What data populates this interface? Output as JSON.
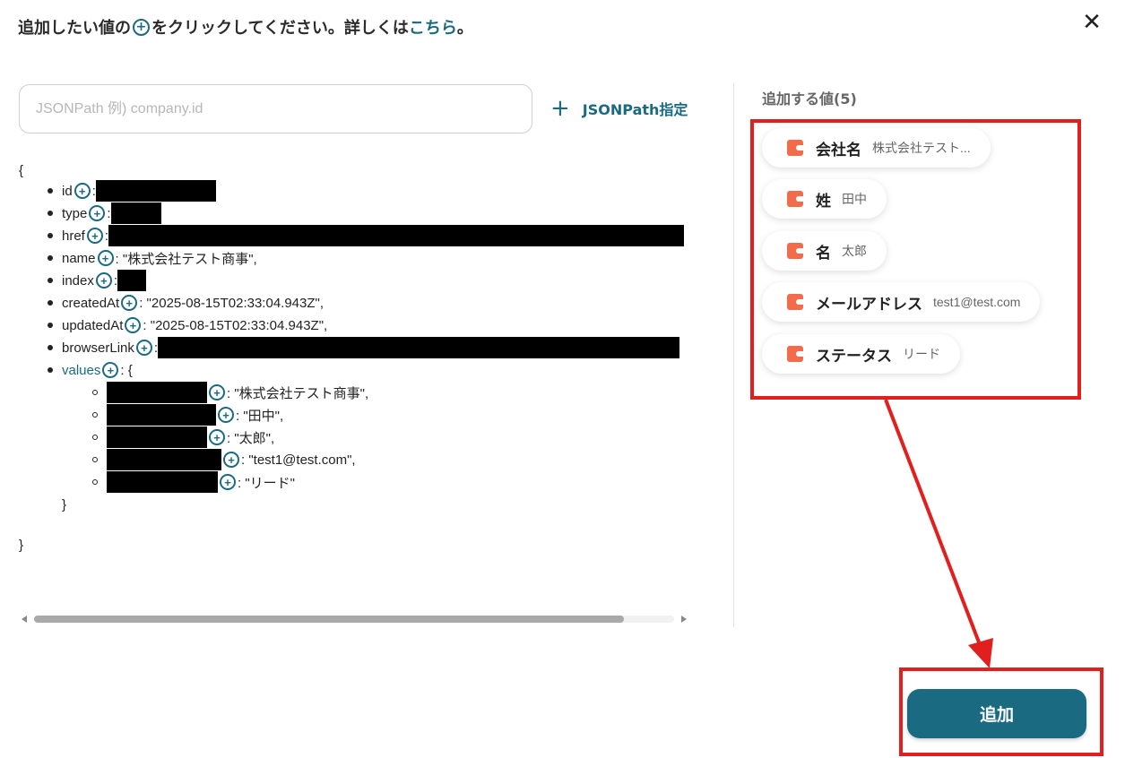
{
  "header": {
    "instruction_before": "追加したい値の",
    "instruction_after": "をクリックしてください。詳しくは",
    "link_label": "こちら",
    "period": "。"
  },
  "search": {
    "placeholder": "JSONPath 例) company.id",
    "value": ""
  },
  "jsonpath_button": {
    "label": "JSONPath指定"
  },
  "json_tree": {
    "open_brace": "{",
    "close_brace": "}",
    "items": [
      {
        "key": "id",
        "suffix": ":",
        "value": ""
      },
      {
        "key": "type",
        "suffix": ":",
        "value": ""
      },
      {
        "key": "href",
        "suffix": ":",
        "value": ""
      },
      {
        "key": "name",
        "suffix": ": \"株式会社テスト商事\",",
        "value": ""
      },
      {
        "key": "index",
        "suffix": ":",
        "value": ""
      },
      {
        "key": "createdAt",
        "suffix": ": \"2025-08-15T02:33:04.943Z\",",
        "value": ""
      },
      {
        "key": "updatedAt",
        "suffix": ": \"2025-08-15T02:33:04.943Z\",",
        "value": ""
      },
      {
        "key": "browserLink",
        "suffix": ":",
        "value": ""
      },
      {
        "key": "values",
        "suffix": ": {",
        "value": ""
      }
    ],
    "sub_items": [
      {
        "suffix": ": \"株式会社テスト商事\","
      },
      {
        "suffix": ": \"田中\","
      },
      {
        "suffix": ": \"太郎\","
      },
      {
        "suffix": ": \"test1@test.com\","
      },
      {
        "suffix": ": \"リード\""
      }
    ],
    "sub_close": "}"
  },
  "scrollbar": {
    "position_fraction": 0.9
  },
  "values_panel": {
    "title": "追加する値(5)",
    "chips": [
      {
        "label": "会社名",
        "value": "株式会社テスト..."
      },
      {
        "label": "姓",
        "value": "田中"
      },
      {
        "label": "名",
        "value": "太郎"
      },
      {
        "label": "メールアドレス",
        "value": "test1@test.com"
      },
      {
        "label": "ステータス",
        "value": "リード"
      }
    ]
  },
  "add_button": {
    "label": "追加"
  },
  "close_icon": "close-icon",
  "colors": {
    "accent": "#1a6a82",
    "highlight": "#e21f1f",
    "chip_icon": "#f26b4b"
  }
}
